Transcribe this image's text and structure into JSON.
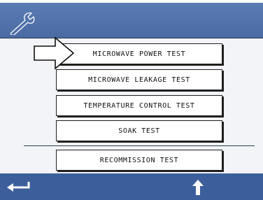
{
  "header": {
    "icon": "wrench-icon",
    "color": "#4f70a8"
  },
  "menu": {
    "items": [
      {
        "label": "MICROWAVE POWER TEST"
      },
      {
        "label": "MICROWAVE LEAKAGE TEST"
      },
      {
        "label": "TEMPERATURE CONTROL TEST"
      },
      {
        "label": "SOAK TEST"
      },
      {
        "label": "RECOMMISSION TEST"
      }
    ],
    "selected_indicator": "arrow-pointer-icon"
  },
  "footer": {
    "back_icon": "return-arrow-icon",
    "up_icon": "up-arrow-icon",
    "color": "#3c5f9c"
  }
}
